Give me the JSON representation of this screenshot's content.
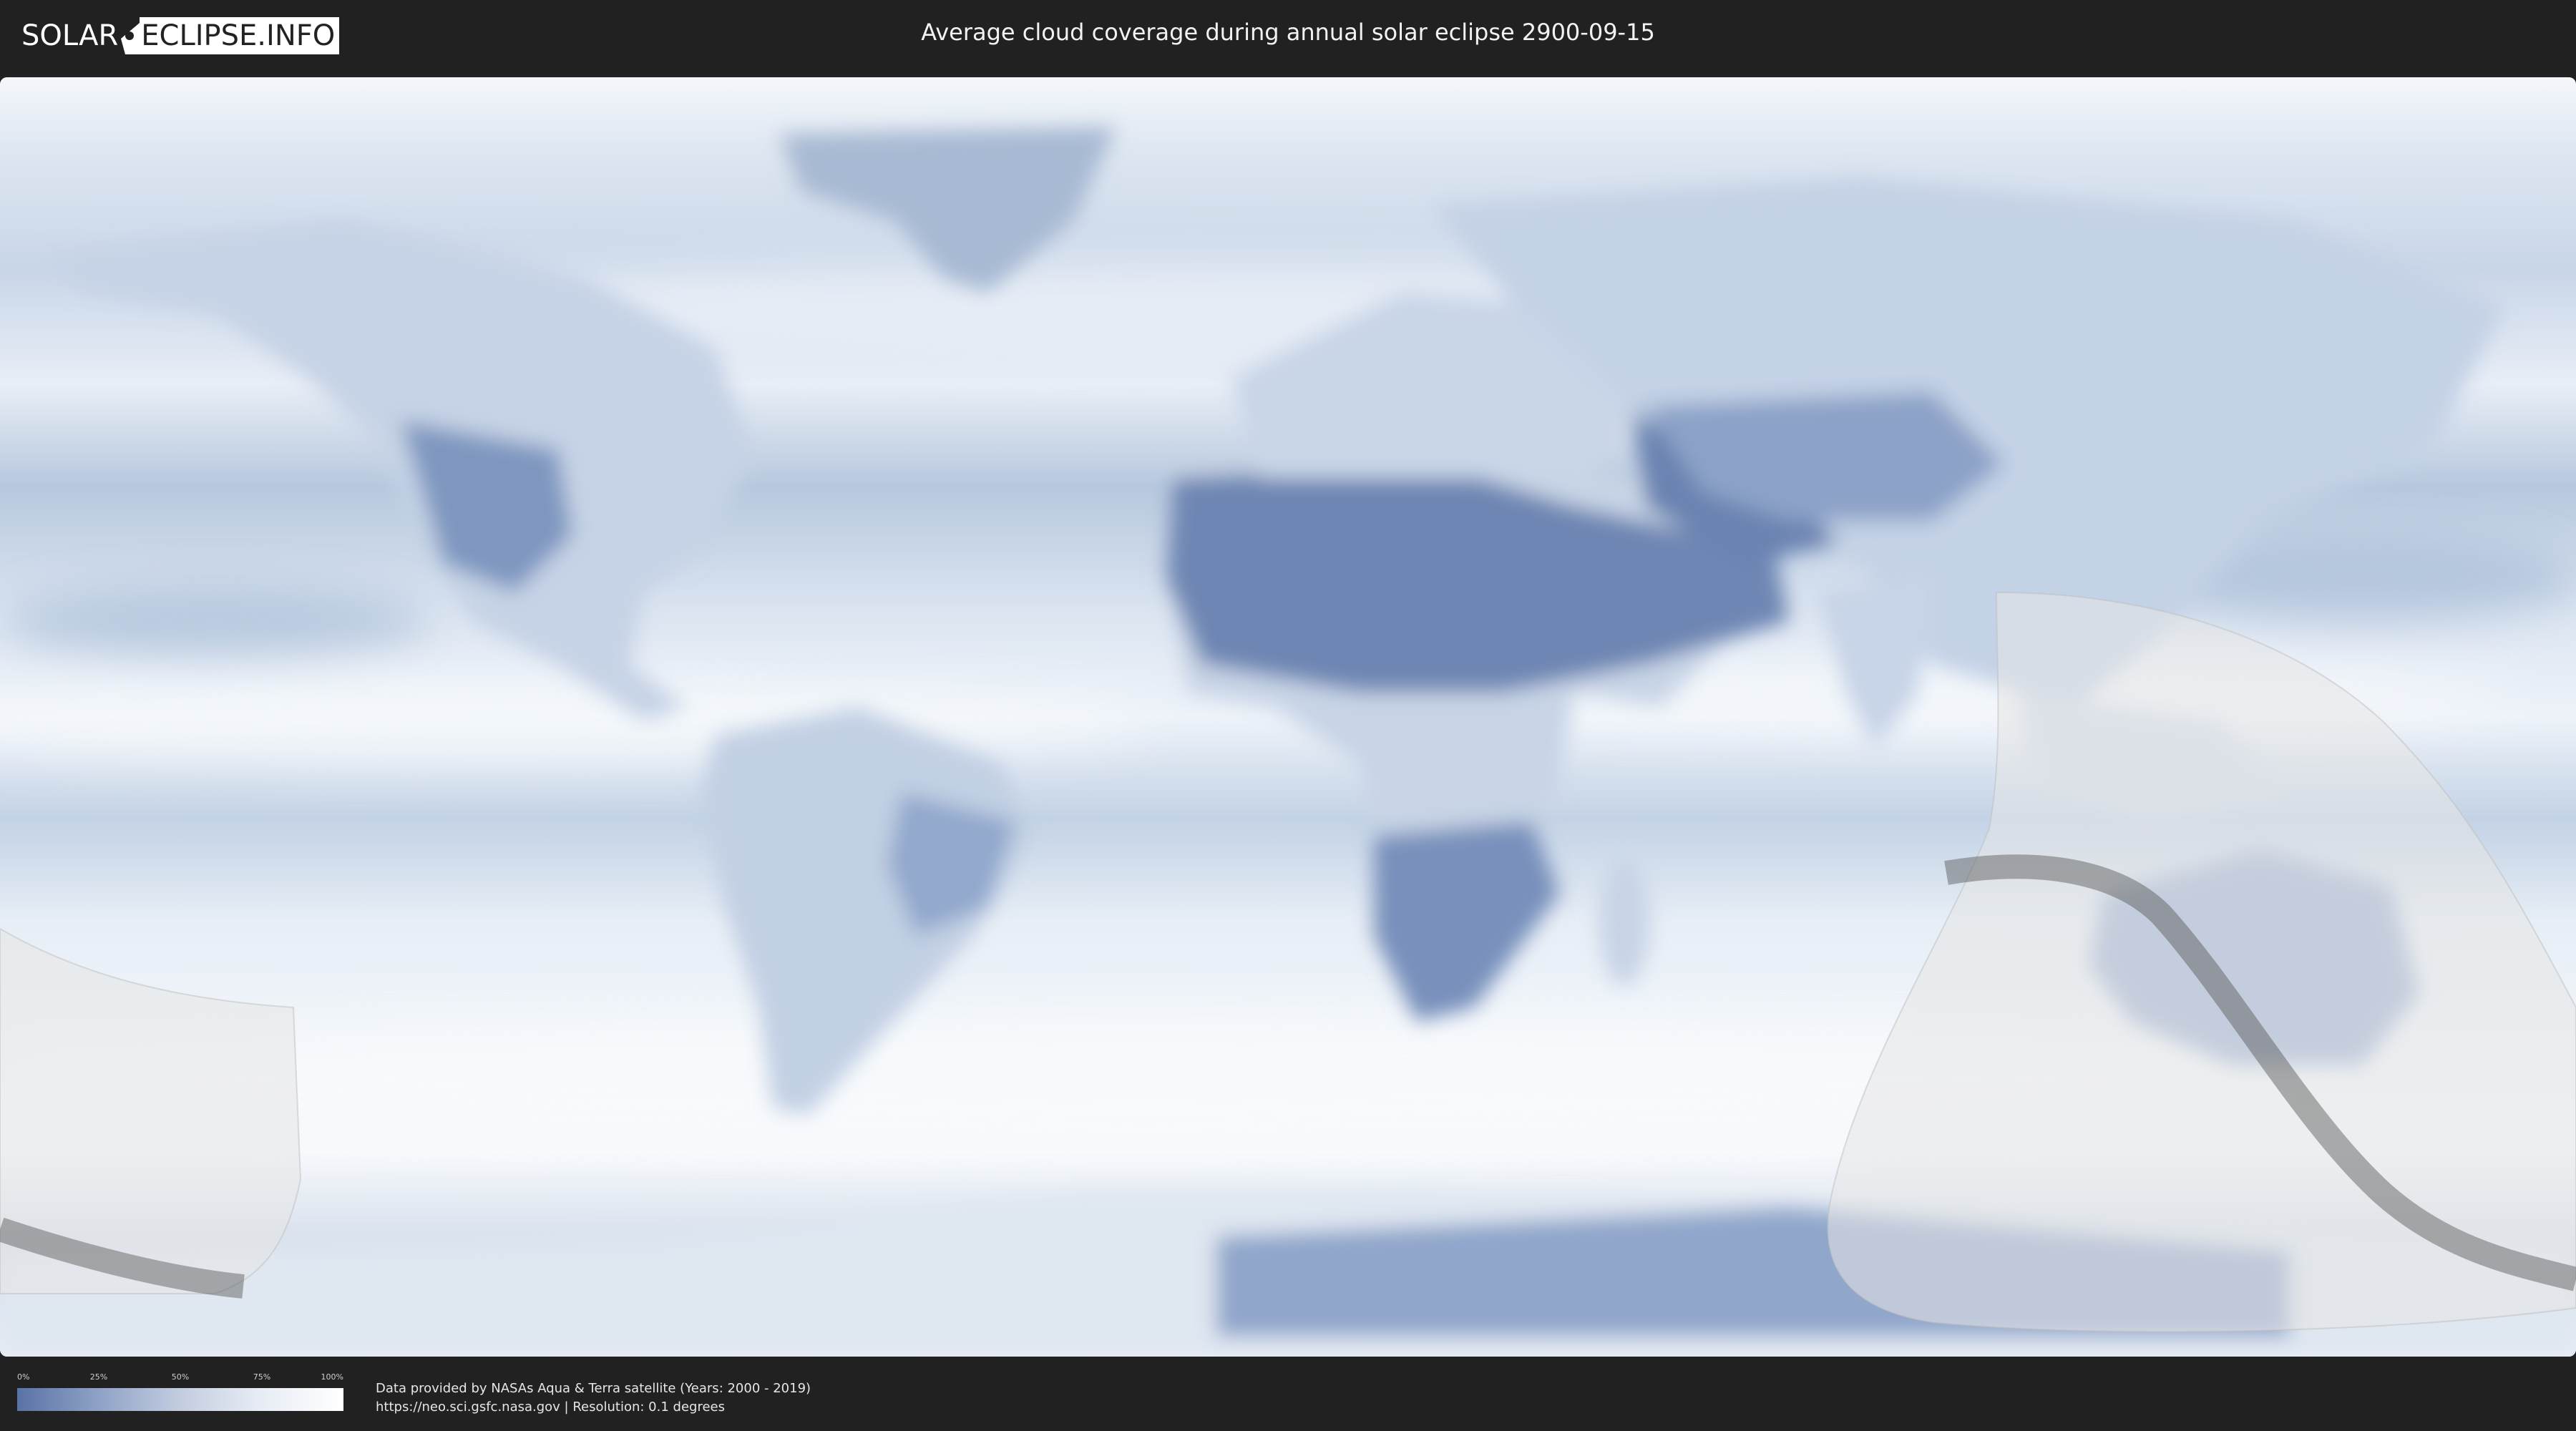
{
  "header": {
    "logo_left": "SOLAR",
    "logo_right": "ECLIPSE.INFO",
    "title": "Average cloud coverage during annual solar eclipse 2900-09-15"
  },
  "map": {
    "colors": {
      "clear_sky": "#5a73a6",
      "full_cloud": "#ffffff",
      "eclipse_zone": "#e6e6e6",
      "path_line": "#555555"
    }
  },
  "legend": {
    "ticks": [
      "0%",
      "25%",
      "50%",
      "75%",
      "100%"
    ],
    "colors": [
      "#5a73a6",
      "#8fa2c6",
      "#c3cde0",
      "#e8edf5",
      "#ffffff"
    ]
  },
  "credits": {
    "line1": "Data provided by NASAs Aqua & Terra satellite (Years: 2000 - 2019)",
    "line2": "https://neo.sci.gsfc.nasa.gov | Resolution: 0.1 degrees"
  }
}
